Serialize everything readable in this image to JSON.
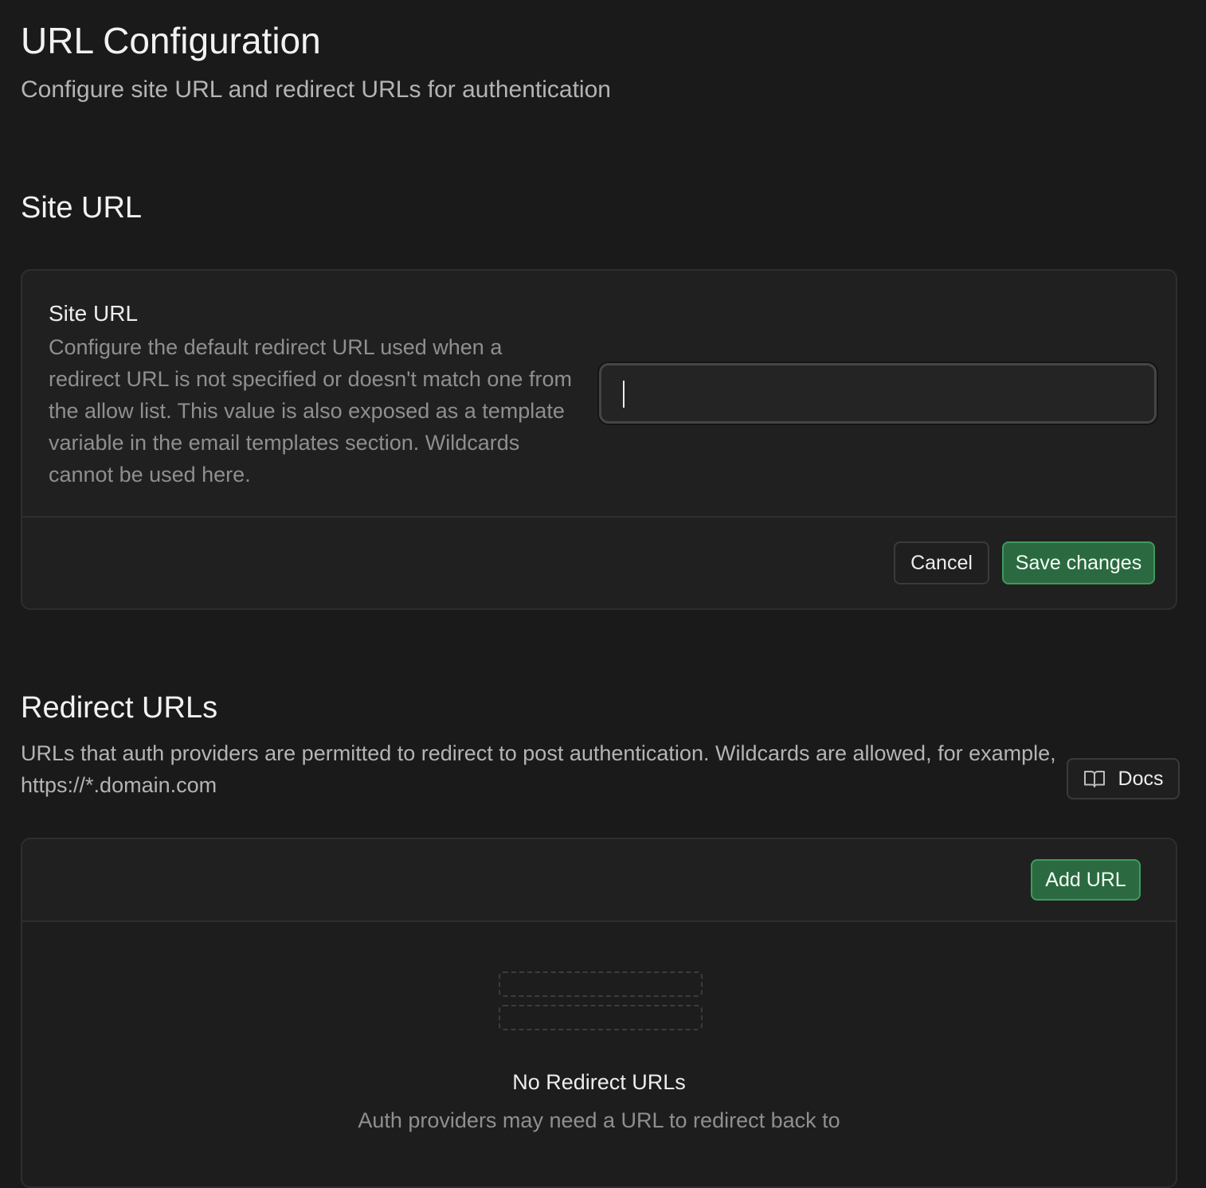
{
  "header": {
    "title": "URL Configuration",
    "subtitle": "Configure site URL and redirect URLs for authentication"
  },
  "site_url_section": {
    "heading": "Site URL",
    "field": {
      "label": "Site URL",
      "description": "Configure the default redirect URL used when a redirect URL is not specified or doesn't match one from the allow list. This value is also exposed as a template variable in the email templates section. Wildcards cannot be used here.",
      "value": ""
    },
    "cancel_label": "Cancel",
    "save_label": "Save changes"
  },
  "redirect_section": {
    "heading": "Redirect URLs",
    "description": "URLs that auth providers are permitted to redirect to post authentication. Wildcards are allowed, for example, https://*.domain.com",
    "docs_label": "Docs",
    "docs_icon": "book-open-icon",
    "add_url_label": "Add URL",
    "empty_state": {
      "title": "No Redirect URLs",
      "description": "Auth providers may need a URL to redirect back to"
    }
  },
  "colors": {
    "background": "#1a1a1a",
    "card": "#202020",
    "border": "#2e2e2e",
    "primary_button": "#2b6a40",
    "primary_border": "#3f9a5e",
    "muted_text": "#8f8f8f"
  }
}
